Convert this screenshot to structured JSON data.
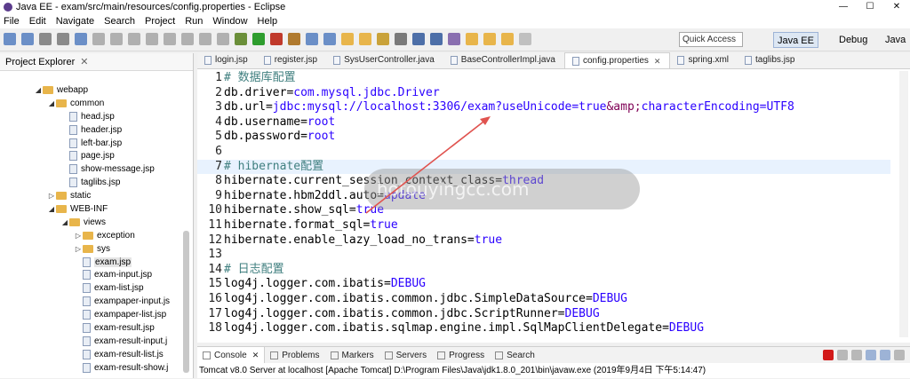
{
  "window": {
    "title": "Java EE - exam/src/main/resources/config.properties - Eclipse"
  },
  "menu": [
    "File",
    "Edit",
    "Navigate",
    "Search",
    "Project",
    "Run",
    "Window",
    "Help"
  ],
  "toolbar": {
    "quick_access_placeholder": "Quick Access",
    "perspectives": [
      "Java EE",
      "Debug",
      "Java"
    ]
  },
  "explorer": {
    "title": "Project Explorer",
    "tree": [
      {
        "label": "webapp",
        "type": "folder",
        "indent": 1,
        "open": true
      },
      {
        "label": "common",
        "type": "folder",
        "indent": 2,
        "open": true
      },
      {
        "label": "head.jsp",
        "type": "file",
        "indent": 3
      },
      {
        "label": "header.jsp",
        "type": "file",
        "indent": 3
      },
      {
        "label": "left-bar.jsp",
        "type": "file",
        "indent": 3
      },
      {
        "label": "page.jsp",
        "type": "file",
        "indent": 3
      },
      {
        "label": "show-message.jsp",
        "type": "file",
        "indent": 3
      },
      {
        "label": "taglibs.jsp",
        "type": "file",
        "indent": 3
      },
      {
        "label": "static",
        "type": "folder",
        "indent": 2,
        "open": false
      },
      {
        "label": "WEB-INF",
        "type": "folder",
        "indent": 2,
        "open": true
      },
      {
        "label": "views",
        "type": "folder",
        "indent": 3,
        "open": true
      },
      {
        "label": "exception",
        "type": "folder",
        "indent": 4,
        "open": false
      },
      {
        "label": "sys",
        "type": "folder",
        "indent": 4,
        "open": false
      },
      {
        "label": "exam.jsp",
        "type": "file",
        "indent": 4,
        "selected": true
      },
      {
        "label": "exam-input.jsp",
        "type": "file",
        "indent": 4
      },
      {
        "label": "exam-list.jsp",
        "type": "file",
        "indent": 4
      },
      {
        "label": "exampaper-input.js",
        "type": "file",
        "indent": 4
      },
      {
        "label": "exampaper-list.jsp",
        "type": "file",
        "indent": 4
      },
      {
        "label": "exam-result.jsp",
        "type": "file",
        "indent": 4
      },
      {
        "label": "exam-result-input.j",
        "type": "file",
        "indent": 4
      },
      {
        "label": "exam-result-list.js",
        "type": "file",
        "indent": 4
      },
      {
        "label": "exam-result-show.j",
        "type": "file",
        "indent": 4
      }
    ]
  },
  "editor": {
    "tabs": [
      {
        "label": "login.jsp",
        "active": false
      },
      {
        "label": "register.jsp",
        "active": false
      },
      {
        "label": "SysUserController.java",
        "active": false
      },
      {
        "label": "BaseControllerImpl.java",
        "active": false
      },
      {
        "label": "config.properties",
        "active": true
      },
      {
        "label": "spring.xml",
        "active": false
      },
      {
        "label": "taglibs.jsp",
        "active": false
      }
    ],
    "lines": [
      {
        "n": "1",
        "parts": [
          [
            "cmt",
            "# 数据库配置"
          ]
        ]
      },
      {
        "n": "2",
        "parts": [
          [
            "key",
            "db.driver="
          ],
          [
            "val",
            "com.mysql.jdbc.Driver"
          ]
        ]
      },
      {
        "n": "3",
        "parts": [
          [
            "key",
            "db.url="
          ],
          [
            "val",
            "jdbc:mysql://localhost:3306/exam?useUnicode=true"
          ],
          [
            "escape",
            "&amp;"
          ],
          [
            "val",
            "characterEncoding=UTF8"
          ]
        ]
      },
      {
        "n": "4",
        "parts": [
          [
            "key",
            "db.username="
          ],
          [
            "val",
            "root"
          ]
        ]
      },
      {
        "n": "5",
        "parts": [
          [
            "key",
            "db.password="
          ],
          [
            "val",
            "root"
          ]
        ]
      },
      {
        "n": "6",
        "parts": [
          [
            "key",
            ""
          ]
        ]
      },
      {
        "n": "7",
        "parts": [
          [
            "cmt",
            "# hibernate配置"
          ]
        ],
        "current": true
      },
      {
        "n": "8",
        "parts": [
          [
            "key",
            "hibernate.current_session_context_class="
          ],
          [
            "val",
            "thread"
          ]
        ]
      },
      {
        "n": "9",
        "parts": [
          [
            "key",
            "hibernate.hbm2ddl.auto="
          ],
          [
            "val",
            "update"
          ]
        ]
      },
      {
        "n": "10",
        "parts": [
          [
            "key",
            "hibernate.show_sql="
          ],
          [
            "val",
            "true"
          ]
        ]
      },
      {
        "n": "11",
        "parts": [
          [
            "key",
            "hibernate.format_sql="
          ],
          [
            "val",
            "true"
          ]
        ]
      },
      {
        "n": "12",
        "parts": [
          [
            "key",
            "hibernate.enable_lazy_load_no_trans="
          ],
          [
            "val",
            "true"
          ]
        ]
      },
      {
        "n": "13",
        "parts": [
          [
            "key",
            ""
          ]
        ]
      },
      {
        "n": "14",
        "parts": [
          [
            "cmt",
            "# 日志配置"
          ]
        ]
      },
      {
        "n": "15",
        "parts": [
          [
            "key",
            "log4j.logger.com.ibatis="
          ],
          [
            "val",
            "DEBUG"
          ]
        ]
      },
      {
        "n": "16",
        "parts": [
          [
            "key",
            "log4j.logger.com.ibatis.common.jdbc.SimpleDataSource="
          ],
          [
            "val",
            "DEBUG"
          ]
        ]
      },
      {
        "n": "17",
        "parts": [
          [
            "key",
            "log4j.logger.com.ibatis.common.jdbc.ScriptRunner="
          ],
          [
            "val",
            "DEBUG"
          ]
        ]
      },
      {
        "n": "18",
        "parts": [
          [
            "key",
            "log4j.logger.com.ibatis.sqlmap.engine.impl.SqlMapClientDelegate="
          ],
          [
            "val",
            "DEBUG"
          ]
        ]
      }
    ]
  },
  "watermark": {
    "text": "hotouyingcc.com"
  },
  "console": {
    "tabs": [
      "Console",
      "Problems",
      "Markers",
      "Servers",
      "Progress",
      "Search"
    ],
    "status": "Tomcat v8.0 Server at localhost [Apache Tomcat] D:\\Program Files\\Java\\jdk1.8.0_201\\bin\\javaw.exe (2019年9月4日 下午5:14:47)"
  },
  "colors": {
    "accent": "#5b3c8c",
    "run": "#2e9d2e",
    "stop": "#d21a1a"
  }
}
